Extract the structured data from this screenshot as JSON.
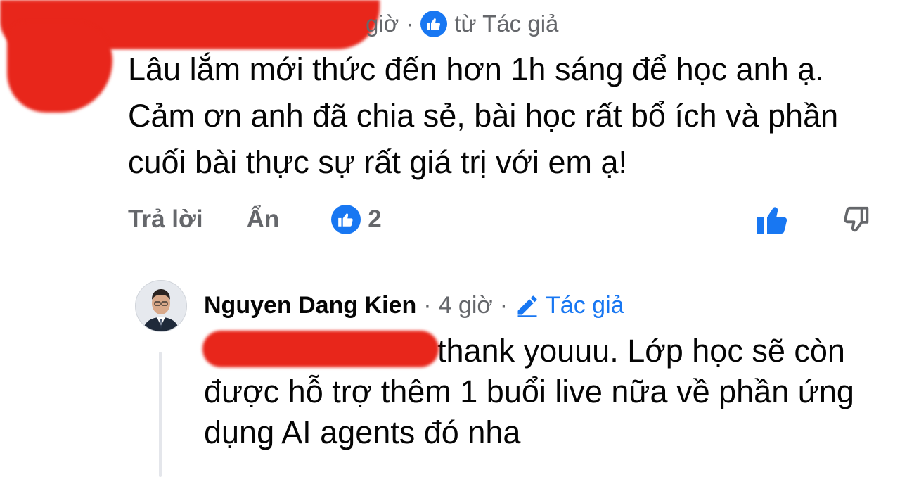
{
  "comment": {
    "meta_time": "giờ",
    "meta_sep": "·",
    "meta_reaction_from": "từ Tác giả",
    "text": "Lâu lắm mới thức đến hơn 1h sáng để học anh ạ. Cảm ơn anh đã chia sẻ, bài học rất bổ ích và phần cuối bài thực sự rất giá trị với em ạ!",
    "actions": {
      "reply_label": "Trả lời",
      "hide_label": "Ẩn",
      "like_count": "2"
    }
  },
  "reply": {
    "author": "Nguyen Dang Kien",
    "sep1": "·",
    "time": "4 giờ",
    "sep2": "·",
    "author_tag": "Tác giả",
    "text": "thank youuu. Lớp học sẽ còn được hỗ trợ thêm 1 buổi live nữa về phần ứng dụng AI agents đó nha"
  },
  "colors": {
    "facebook_blue": "#1877f2",
    "secondary_text": "#65676b",
    "redaction_red": "#e8261b"
  },
  "icons": [
    "like-badge-icon",
    "thumb-up-icon",
    "thumb-down-icon",
    "pencil-icon"
  ]
}
